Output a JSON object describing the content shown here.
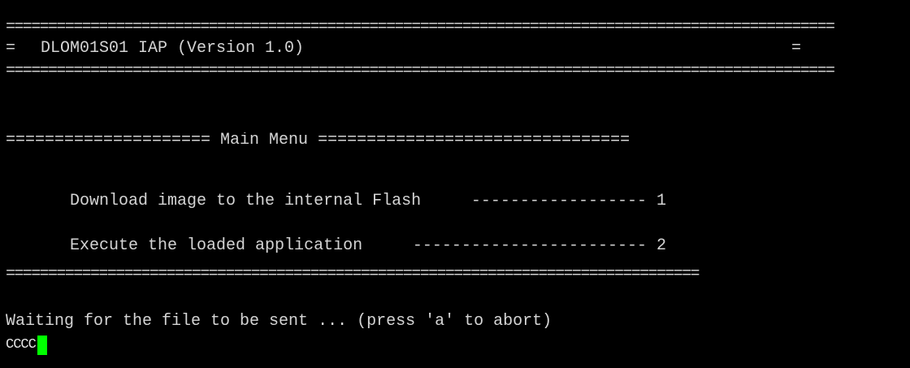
{
  "terminal": {
    "colors": {
      "background": "#000000",
      "text": "#d4d4d4",
      "cursor": "#00ff00"
    },
    "banner": {
      "rule_top": "==================================================================================================",
      "left_marker": "=",
      "title": "DLOM01S01 IAP (Version 1.0)",
      "right_marker": "=",
      "rule_bottom": "=================================================================================================="
    },
    "menu": {
      "header": "===================== Main Menu ================================",
      "items": [
        {
          "label": "Download image to the internal Flash",
          "dashes": "------------------",
          "key": "1"
        },
        {
          "label": "Execute the loaded application",
          "dashes": "------------------------",
          "key": "2"
        }
      ],
      "separator": "=================================================================================="
    },
    "status": "Waiting for the file to be sent ... (press 'a' to abort)",
    "prompt_text": "CCCC"
  }
}
